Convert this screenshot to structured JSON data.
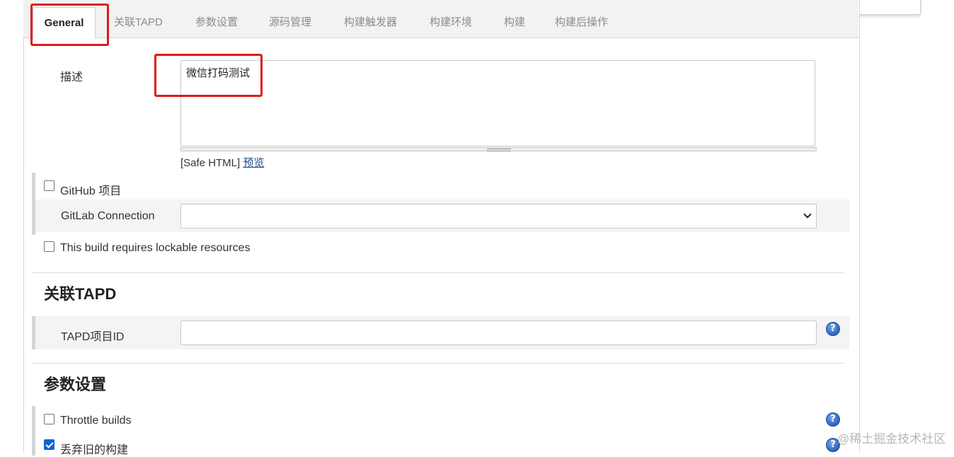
{
  "tabs": [
    {
      "label": "General",
      "active": true
    },
    {
      "label": "关联TAPD"
    },
    {
      "label": "参数设置"
    },
    {
      "label": "源码管理"
    },
    {
      "label": "构建触发器"
    },
    {
      "label": "构建环境"
    },
    {
      "label": "构建"
    },
    {
      "label": "构建后操作"
    }
  ],
  "general": {
    "description_label": "描述",
    "description_value": "微信打码测试",
    "safe_html": "[Safe HTML]",
    "preview_link": "预览",
    "github_project_label": "GitHub 项目",
    "gitlab_connection_label": "GitLab Connection",
    "gitlab_connection_value": "",
    "lockable_resources_label": "This build requires lockable resources"
  },
  "tapd": {
    "section_title": "关联TAPD",
    "project_id_label": "TAPD项目ID",
    "project_id_value": ""
  },
  "params": {
    "section_title": "参数设置",
    "throttle_label": "Throttle builds",
    "discard_old_label": "丢弃旧的构建",
    "discard_old_checked": true
  },
  "watermark": "@稀土掘金技术社区",
  "colors": {
    "highlight": "#e0191b",
    "link": "#204a87",
    "checkbox_checked": "#0b63d6"
  }
}
